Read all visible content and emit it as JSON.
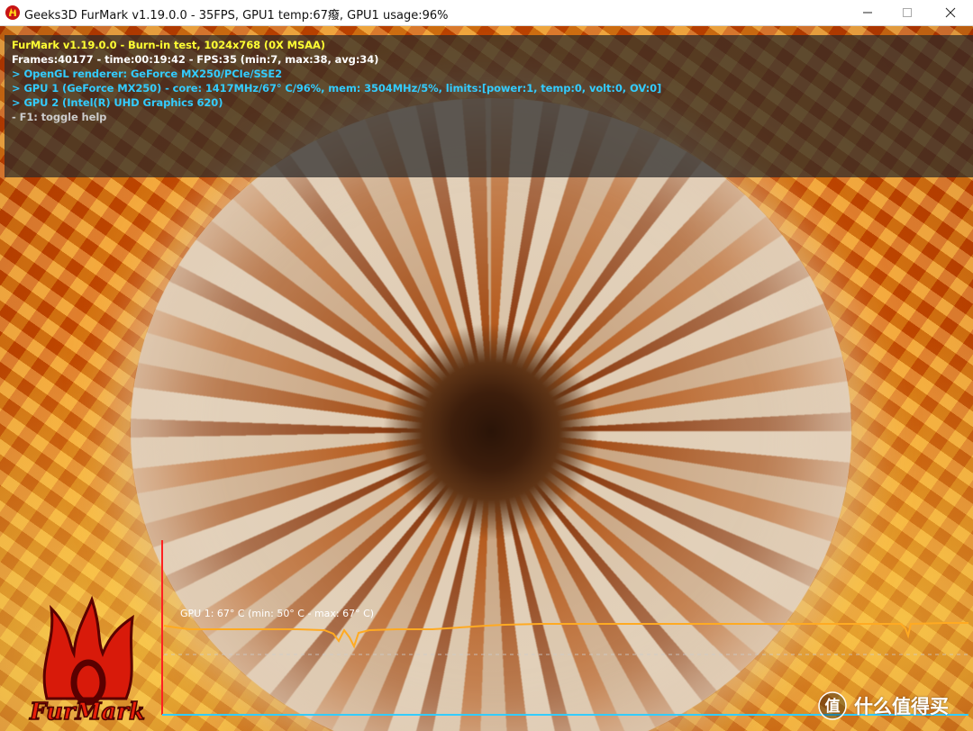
{
  "window": {
    "title": "Geeks3D FurMark v1.19.0.0 - 35FPS, GPU1 temp:67癈, GPU1 usage:96%",
    "icon": "furmark-app-icon"
  },
  "hud": {
    "lines": [
      {
        "text": "FurMark v1.19.0.0 - Burn-in test, 1024x768 (0X MSAA)",
        "color": "#ffff33"
      },
      {
        "text": "Frames:40177 - time:00:19:42 - FPS:35 (min:7, max:38, avg:34)",
        "color": "#ffffff"
      },
      {
        "text": "> OpenGL renderer: GeForce MX250/PCIe/SSE2",
        "color": "#33ccff"
      },
      {
        "text": "> GPU 1 (GeForce MX250) - core: 1417MHz/67° C/96%, mem: 3504MHz/5%, limits:[power:1, temp:0, volt:0, OV:0]",
        "color": "#33ccff"
      },
      {
        "text": "> GPU 2 (Intel(R) UHD Graphics 620)",
        "color": "#33ccff"
      },
      {
        "text": "- F1: toggle help",
        "color": "#cccccc"
      }
    ]
  },
  "graph": {
    "label": "GPU 1: 67° C (min: 50° C - max: 67° C)",
    "line_color": "#ffaa22",
    "axis_color": "#ff2020",
    "baseline_color": "#33ccff"
  },
  "logo": {
    "text": "FurMark"
  },
  "watermark": {
    "text": "什么值得买",
    "icon": "zhi-logo-icon"
  }
}
